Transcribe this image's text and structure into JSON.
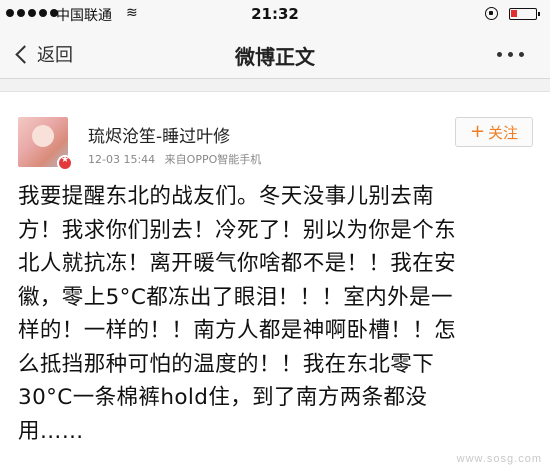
{
  "status_bar": {
    "carrier": "中国联通",
    "wifi_glyph": "≋",
    "time": "21:32"
  },
  "nav": {
    "back_label": "返回",
    "title": "微博正文"
  },
  "post": {
    "username": "琉烬沧笙-睡过叶修",
    "date": "12-03 15:44",
    "source": "来自OPPO智能手机",
    "follow_label": "关注",
    "follow_icon_glyph": "+",
    "lines": [
      "我要提醒东北的战友们。冬天没事儿别去南",
      "方！我求你们别去！冷死了！别以为你是个东",
      "北人就抗冻！离开暖气你啥都不是！！我在安",
      "徽，零上5°C都冻出了眼泪！！！室内外是一",
      "样的！一样的！！南方人都是神啊卧槽！！怎",
      "么抵挡那种可怕的温度的！！我在东北零下",
      "30°C一条棉裤hold住，到了南方两条都没",
      "用……"
    ]
  },
  "watermark": "www.sosg.com",
  "colors": {
    "accent_orange": "#f07d22",
    "badge_red": "#e4393c",
    "battery_red": "#e03030"
  }
}
